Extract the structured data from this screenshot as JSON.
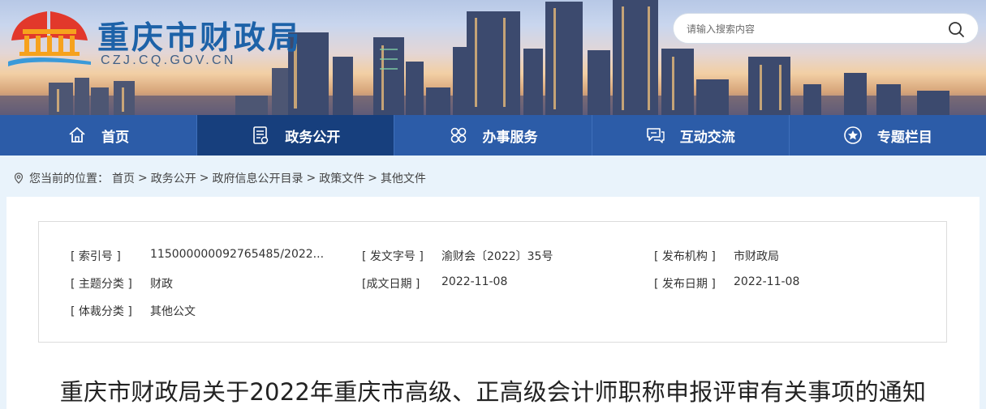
{
  "header": {
    "site_title": "重庆市财政局",
    "site_domain": "CZJ.CQ.GOV.CN",
    "search": {
      "placeholder": "请输入搜索内容",
      "icon": "search-icon"
    }
  },
  "nav": [
    {
      "label": "首页",
      "icon": "home-icon",
      "active": false
    },
    {
      "label": "政务公开",
      "icon": "document-list-icon",
      "active": true
    },
    {
      "label": "办事服务",
      "icon": "grid-clover-icon",
      "active": false
    },
    {
      "label": "互动交流",
      "icon": "chat-bubble-icon",
      "active": false
    },
    {
      "label": "专题栏目",
      "icon": "star-circle-icon",
      "active": false
    }
  ],
  "breadcrumb": {
    "prefix": "您当前的位置：",
    "items": [
      "首页",
      "政务公开",
      "政府信息公开目录",
      "政策文件",
      "其他文件"
    ],
    "separator": ">"
  },
  "meta": {
    "index_no": {
      "label": "[ 索引号 ]",
      "value": "115000000092765485/2022..."
    },
    "doc_no": {
      "label": "[ 发文字号 ]",
      "value": "渝财会〔2022〕35号"
    },
    "publisher": {
      "label": "[ 发布机构 ]",
      "value": "市财政局"
    },
    "topic": {
      "label": "[ 主题分类 ]",
      "value": "财政"
    },
    "created": {
      "label": "[成文日期 ]",
      "value": "2022-11-08"
    },
    "published": {
      "label": "[ 发布日期 ]",
      "value": "2022-11-08"
    },
    "genre": {
      "label": "[ 体裁分类 ]",
      "value": "其他公文"
    }
  },
  "document": {
    "title": "重庆市财政局关于2022年重庆市高级、正高级会计师职称申报评审有关事项的通知"
  },
  "colors": {
    "nav_bg": "#2c5ca8",
    "nav_active": "#173f7d",
    "brand_blue": "#1d62a8",
    "page_bg": "#e9f3fb"
  }
}
